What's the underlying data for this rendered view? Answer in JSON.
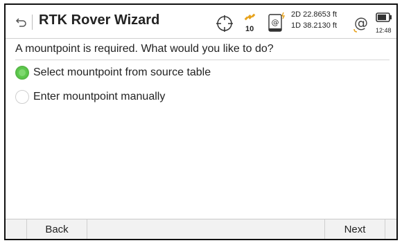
{
  "header": {
    "title": "RTK Rover Wizard",
    "satellites": "10",
    "precision_2d": "2D 22.8653 ft",
    "precision_1d": "1D 38.2130 ft",
    "time": "12:48"
  },
  "main": {
    "prompt": "A mountpoint is required. What would you like to do?",
    "options": [
      {
        "label": "Select mountpoint from source table",
        "selected": true
      },
      {
        "label": "Enter mountpoint manually",
        "selected": false
      }
    ]
  },
  "footer": {
    "back_label": "Back",
    "next_label": "Next"
  },
  "colors": {
    "accent_green": "#5cc84c",
    "satellite_orange": "#e7a21c"
  }
}
